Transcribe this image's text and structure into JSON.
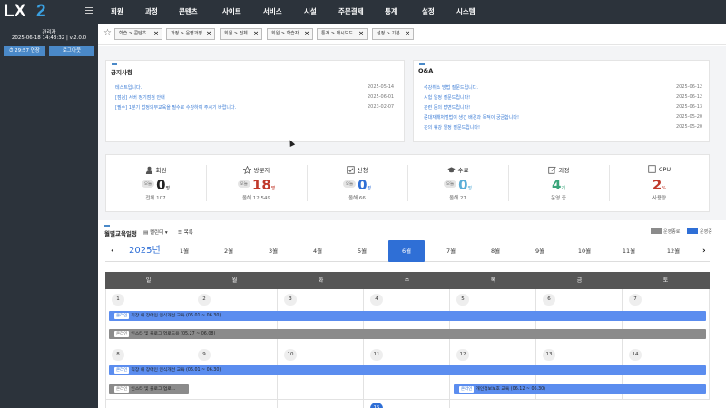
{
  "sidebar": {
    "logo_main": "LX",
    "logo_num": "2",
    "user": "관리자",
    "version_line": "2025-06-18 14:48:32 | v.2.0.0",
    "session_button": "⏱ 29:57 연장",
    "logout_button": "로그아웃"
  },
  "nav": [
    "회원",
    "과정",
    "콘텐츠",
    "사이트",
    "서비스",
    "시설",
    "주문결제",
    "통계",
    "설정",
    "시스템"
  ],
  "tabs": [
    "학습 > 콘텐츠",
    "과정 > 운영과정",
    "회원 > 전체",
    "회원 > 학습자",
    "통계 > 대시보드",
    "설정 > 기본"
  ],
  "notice": {
    "title": "공지사항",
    "items": [
      {
        "text": "테스트입니다.",
        "date": "2025-05-14"
      },
      {
        "text": "[점검] 서버 정기점검 안내",
        "date": "2025-06-01"
      },
      {
        "text": "[필수] 1분기 법정의무교육을 필수로 수강하여 주시기 바랍니다.",
        "date": "2023-02-07"
      }
    ]
  },
  "qa": {
    "title": "Q&A",
    "items": [
      {
        "text": "수강취소 방법 질문드립니다.",
        "date": "2025-06-12"
      },
      {
        "text": "시험 일정 질문드립니다!",
        "date": "2025-06-12"
      },
      {
        "text": "관련 문의 답변드립니다!",
        "date": "2025-06-13"
      },
      {
        "text": "중대재해처벌법이 생긴 배경과 목적이 궁금합니다!",
        "date": "2025-05-20"
      },
      {
        "text": "강의 휴강 일정 질문드립니다!",
        "date": "2025-05-20"
      }
    ]
  },
  "stats": [
    {
      "label": "회원",
      "pill": "오늘",
      "value": "0",
      "unit": "명",
      "sub": "전체 107",
      "color": "#222",
      "icon": "user-icon"
    },
    {
      "label": "방문자",
      "pill": "오늘",
      "value": "18",
      "unit": "명",
      "sub": "올해 12,549",
      "color": "#c0392b",
      "icon": "star-icon"
    },
    {
      "label": "신청",
      "pill": "오늘",
      "value": "0",
      "unit": "명",
      "sub": "올해 66",
      "color": "#2f6fd6",
      "icon": "checkbox-icon"
    },
    {
      "label": "수료",
      "pill": "오늘",
      "value": "0",
      "unit": "명",
      "sub": "올해 27",
      "color": "#5aaed8",
      "icon": "graduation-cap-icon"
    },
    {
      "label": "과정",
      "pill": "",
      "value": "4",
      "unit": "개",
      "sub": "운영 중",
      "color": "#3aa57a",
      "icon": "edit-icon"
    },
    {
      "label": "CPU",
      "pill": "",
      "value": "2",
      "unit": "%",
      "sub": "사용량",
      "color": "#c0392b",
      "icon": "square-icon"
    }
  ],
  "schedule": {
    "title": "월별교육일정",
    "calendar_btn": "캘린더",
    "list_btn": "목록",
    "legend_ended": "운영종료",
    "legend_running": "운영중",
    "year": "2025년",
    "months": [
      "1월",
      "2월",
      "3월",
      "4월",
      "5월",
      "6월",
      "7월",
      "8월",
      "9월",
      "10월",
      "11월",
      "12월"
    ],
    "active_month_index": 5,
    "weekdays": [
      "일",
      "월",
      "화",
      "수",
      "목",
      "금",
      "토"
    ],
    "week1_days": [
      "1",
      "2",
      "3",
      "4",
      "5",
      "6",
      "7"
    ],
    "week2_days": [
      "8",
      "9",
      "10",
      "11",
      "12",
      "13",
      "14"
    ],
    "week3_first": "15",
    "events": [
      {
        "tag": "온라인",
        "text": "직장 내 장애인 인식개선 교육 (06.01 ~ 06.30)",
        "style": "blue"
      },
      {
        "tag": "온라인",
        "text": "인스타 및 블로그 업로드용 (05.27 ~ 06.08)",
        "style": "gray"
      },
      {
        "tag": "온라인",
        "text": "직장 내 장애인 인식개선 교육 (06.01 ~ 06.30)",
        "style": "blue"
      },
      {
        "tag": "온라인",
        "text": "인스타 및 블로그 업로...",
        "style": "gray"
      },
      {
        "tag": "온라인",
        "text": "개인정보보호 교육 (06.12 ~ 06.30)",
        "style": "blue"
      }
    ]
  }
}
